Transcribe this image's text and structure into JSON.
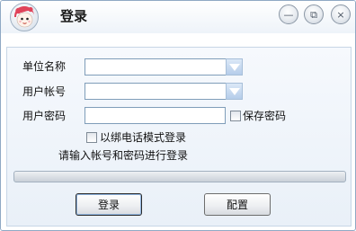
{
  "window": {
    "title": "登录",
    "controls": {
      "minimize": "—",
      "maximize": "⧉",
      "close": "×"
    }
  },
  "form": {
    "unit_name": {
      "label": "单位名称",
      "value": ""
    },
    "account": {
      "label": "用户帐号",
      "value": ""
    },
    "password": {
      "label": "用户密码",
      "value": ""
    },
    "save_password": {
      "label": "保存密码",
      "checked": false
    },
    "phone_mode": {
      "label": "以绑电话模式登录",
      "checked": false
    },
    "hint": "请输入帐号和密码进行登录"
  },
  "progress": {
    "value": 0
  },
  "buttons": {
    "login": "登录",
    "config": "配置"
  },
  "colors": {
    "accent": "#b5cdea",
    "logo": "#e0445a"
  },
  "icons": {
    "logo": "cartoon-avatar-icon",
    "combo": "dropdown-arrow-icon"
  }
}
